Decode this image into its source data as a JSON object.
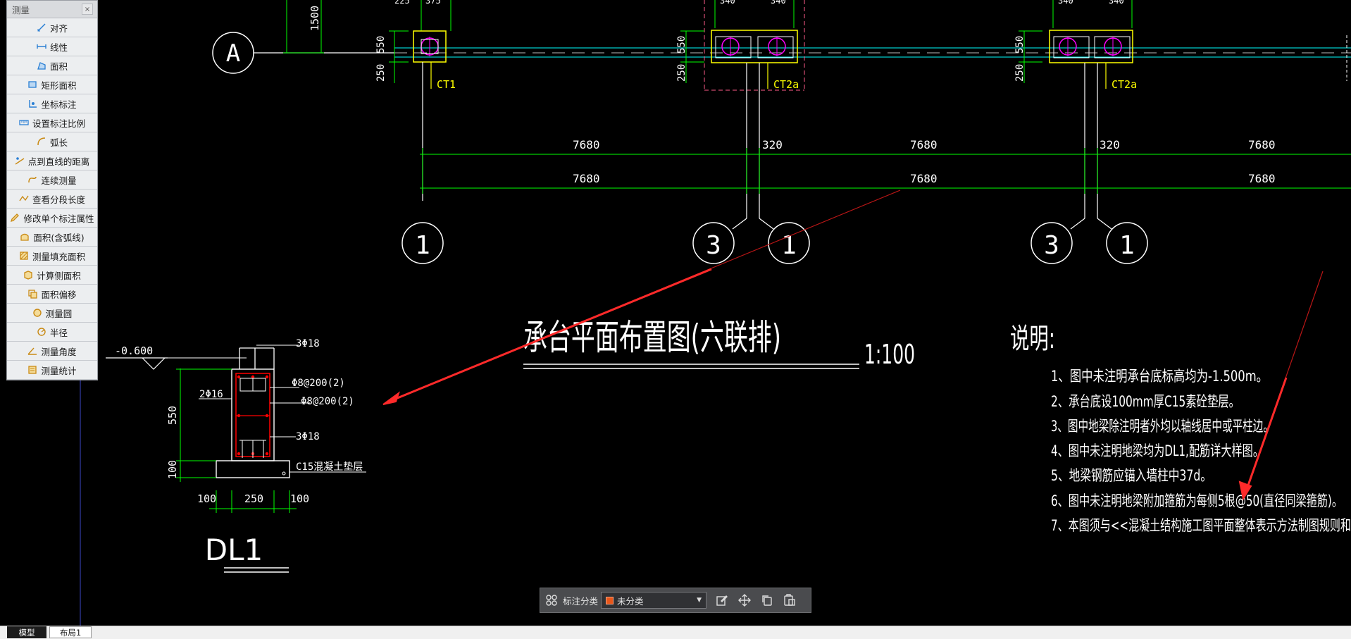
{
  "panel": {
    "title": "测量",
    "close_glyph": "×",
    "items": [
      {
        "label": "对齐",
        "icon": "aligned-dimension-icon"
      },
      {
        "label": "线性",
        "icon": "linear-dimension-icon"
      },
      {
        "label": "面积",
        "icon": "area-icon"
      },
      {
        "label": "矩形面积",
        "icon": "rectangle-area-icon"
      },
      {
        "label": "坐标标注",
        "icon": "coordinate-icon"
      },
      {
        "label": "设置标注比例",
        "icon": "scale-icon"
      },
      {
        "label": "弧长",
        "icon": "arc-length-icon"
      },
      {
        "label": "点到直线的距离",
        "icon": "point-line-distance-icon"
      },
      {
        "label": "连续测量",
        "icon": "continuous-measure-icon"
      },
      {
        "label": "查看分段长度",
        "icon": "segment-length-icon"
      },
      {
        "label": "修改单个标注属性",
        "icon": "edit-dimension-icon"
      },
      {
        "label": "面积(含弧线)",
        "icon": "arc-area-icon"
      },
      {
        "label": "测量填充面积",
        "icon": "fill-area-icon"
      },
      {
        "label": "计算侧面积",
        "icon": "side-area-icon"
      },
      {
        "label": "面积偏移",
        "icon": "area-offset-icon"
      },
      {
        "label": "测量圆",
        "icon": "circle-measure-icon"
      },
      {
        "label": "半径",
        "icon": "radius-icon"
      },
      {
        "label": "测量角度",
        "icon": "angle-icon"
      },
      {
        "label": "测量统计",
        "icon": "statistics-icon"
      }
    ]
  },
  "drawing": {
    "axis_a": "A",
    "top_dims": {
      "d1500": "1500",
      "d550": "550",
      "d250": "250",
      "top_a": "225",
      "top_b": "375",
      "top_c": "340"
    },
    "col_labels": {
      "c1": "CT1",
      "c2": "CT2a",
      "c3": "CT2a"
    },
    "dims": {
      "d7680": "7680",
      "d320": "320"
    },
    "grid_labels": {
      "g1": "1",
      "g3": "3"
    },
    "plan_title": "承台平面布置图(六联排)",
    "plan_scale": "1:100",
    "notes_title": "说明:",
    "notes": [
      "1、图中未注明承台底标高均为-1.500m。",
      "2、承台底设100mm厚C15素砼垫层。",
      "3、图中地梁除注明者外均以轴线居中或平柱边。",
      "4、图中未注明地梁均为DL1,配筋详大样图。",
      "5、地梁钢筋应锚入墙柱中37d。",
      "6、图中未注明地梁附加箍筋为每侧5根@50(直径同梁箍筋)。",
      "7、本图须与<<混凝土结构施工图平面整体表示方法制图规则和"
    ],
    "section": {
      "elev": "-0.600",
      "top_bar": "3Φ18",
      "side_bar": "2Φ16",
      "stirrup1": "Φ8@200(2)",
      "stirrup2": "Φ8@200(2)",
      "bottom_bar": "3Φ18",
      "h550": "550",
      "h100": "100",
      "pad": "C15混凝土垫层",
      "w100a": "100",
      "w250": "250",
      "w100b": "100",
      "name": "DL1"
    }
  },
  "toolbar": {
    "category_label": "标注分类",
    "category_value": "未分类",
    "category_color": "#e8561a"
  },
  "tabs": {
    "model": "模型",
    "layout": "布局1"
  },
  "colors": {
    "background": "#000000",
    "line_white": "#ffffff",
    "dim_green": "#00ff00",
    "axis_cyan": "#00ffff",
    "column_yellow": "#ffff00",
    "magenta": "#ff00ff",
    "rebar_red": "#ff0000",
    "arrow_red": "#ff2a2a"
  }
}
